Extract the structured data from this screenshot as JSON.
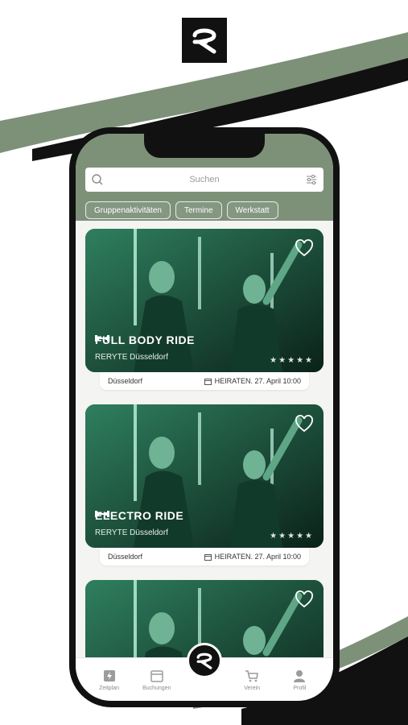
{
  "app": {
    "search": {
      "placeholder": "Suchen"
    },
    "filters": [
      "Gruppenaktivitäten",
      "Termine",
      "Werkstatt"
    ],
    "cards": [
      {
        "title": "FULL BODY RIDE",
        "studio": "RERYTE Düsseldorf",
        "location": "Düsseldorf",
        "date": "HEIRATEN. 27. April 10:00",
        "rating": 5
      },
      {
        "title": "ELECTRO RIDE",
        "studio": "RERYTE Düsseldorf",
        "location": "Düsseldorf",
        "date": "HEIRATEN. 27. April 10:00",
        "rating": 5
      },
      {
        "title": "",
        "studio": "",
        "location": "",
        "date": "",
        "rating": 0
      }
    ],
    "tabs": [
      {
        "label": "Zeitplan",
        "icon": "bolt-icon"
      },
      {
        "label": "Buchungen",
        "icon": "calendar-icon"
      },
      {
        "label": "Verein",
        "icon": "cart-icon"
      },
      {
        "label": "Profil",
        "icon": "user-icon"
      }
    ]
  },
  "colors": {
    "accent": "#7d9179",
    "dark": "#111111",
    "card_green": "#1f6b4d"
  }
}
